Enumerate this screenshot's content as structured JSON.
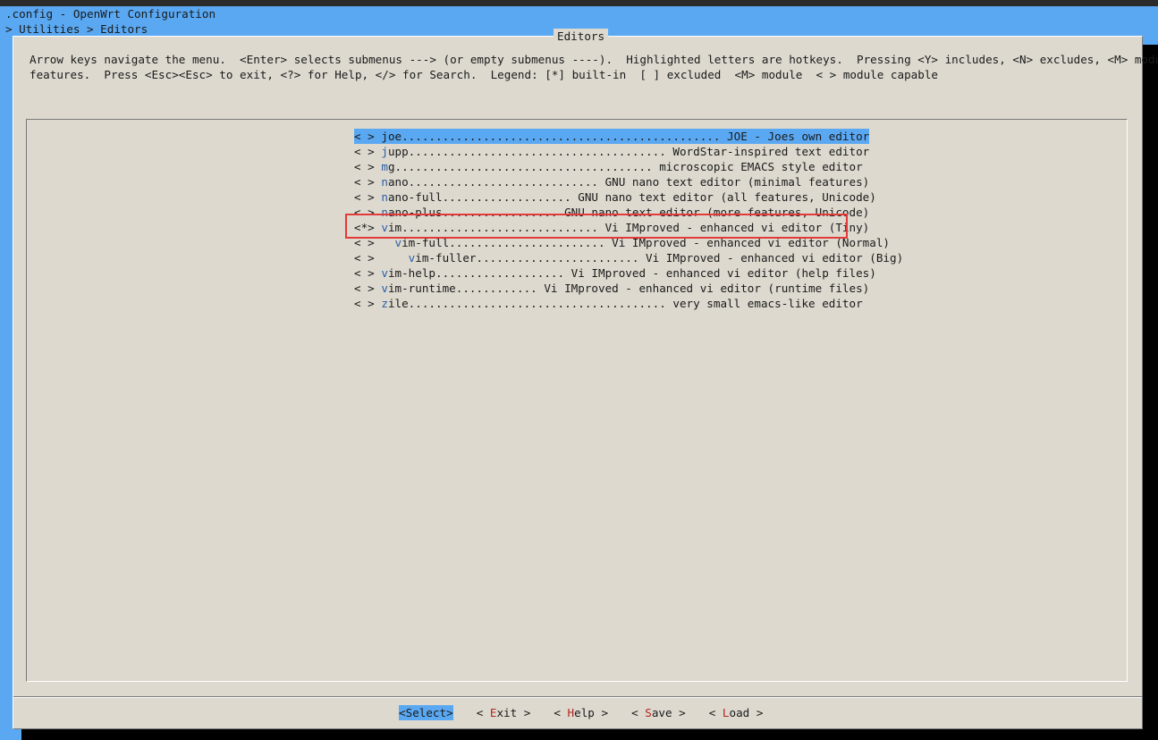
{
  "window": {
    "title": ".config - OpenWrt Configuration",
    "breadcrumb": "> Utilities > Editors"
  },
  "dialog": {
    "title": "Editors",
    "help_lines": [
      "Arrow keys navigate the menu.  <Enter> selects submenus ---> (or empty submenus ----).  Highlighted letters are hotkeys.  Pressing <Y> includes, <N> excludes, <M> modularizes",
      "features.  Press <Esc><Esc> to exit, <?> for Help, </> for Search.  Legend: [*] built-in  [ ] excluded  <M> module  < > module capable"
    ]
  },
  "menu": {
    "items": [
      {
        "state": "< >",
        "indent": "",
        "hotkey": "j",
        "rest": "oe............................................... JOE - Joes own editor"
      },
      {
        "state": "< >",
        "indent": "",
        "hotkey": "j",
        "rest": "upp...................................... WordStar-inspired text editor"
      },
      {
        "state": "< >",
        "indent": "",
        "hotkey": "m",
        "rest": "g...................................... microscopic EMACS style editor"
      },
      {
        "state": "< >",
        "indent": "",
        "hotkey": "n",
        "rest": "ano............................ GNU nano text editor (minimal features)"
      },
      {
        "state": "< >",
        "indent": "",
        "hotkey": "n",
        "rest": "ano-full................... GNU nano text editor (all features, Unicode)"
      },
      {
        "state": "< >",
        "indent": "",
        "hotkey": "n",
        "rest": "ano-plus................. GNU nano text editor (more features, Unicode)"
      },
      {
        "state": "<*>",
        "indent": "",
        "hotkey": "v",
        "rest": "im............................. Vi IMproved - enhanced vi editor (Tiny)"
      },
      {
        "state": "< >",
        "indent": "  ",
        "hotkey": "v",
        "rest": "im-full....................... Vi IMproved - enhanced vi editor (Normal)"
      },
      {
        "state": "< >",
        "indent": "    ",
        "hotkey": "v",
        "rest": "im-fuller........................ Vi IMproved - enhanced vi editor (Big)"
      },
      {
        "state": "< >",
        "indent": "",
        "hotkey": "v",
        "rest": "im-help................... Vi IMproved - enhanced vi editor (help files)"
      },
      {
        "state": "< >",
        "indent": "",
        "hotkey": "v",
        "rest": "im-runtime............ Vi IMproved - enhanced vi editor (runtime files)"
      },
      {
        "state": "< >",
        "indent": "",
        "hotkey": "z",
        "rest": "ile...................................... very small emacs-like editor"
      }
    ]
  },
  "buttons": [
    {
      "pre": "<",
      "hotkey": "S",
      "post": "elect>"
    },
    {
      "pre": "< ",
      "hotkey": "E",
      "post": "xit >"
    },
    {
      "pre": "< ",
      "hotkey": "H",
      "post": "elp >"
    },
    {
      "pre": "< ",
      "hotkey": "S",
      "post": "ave >"
    },
    {
      "pre": "< ",
      "hotkey": "L",
      "post": "oad >"
    }
  ],
  "colors": {
    "background": "#5aa8f2",
    "dialog": "#ddd9cf",
    "selection": "#5aa8f2",
    "annotation": "#e23a3a"
  }
}
